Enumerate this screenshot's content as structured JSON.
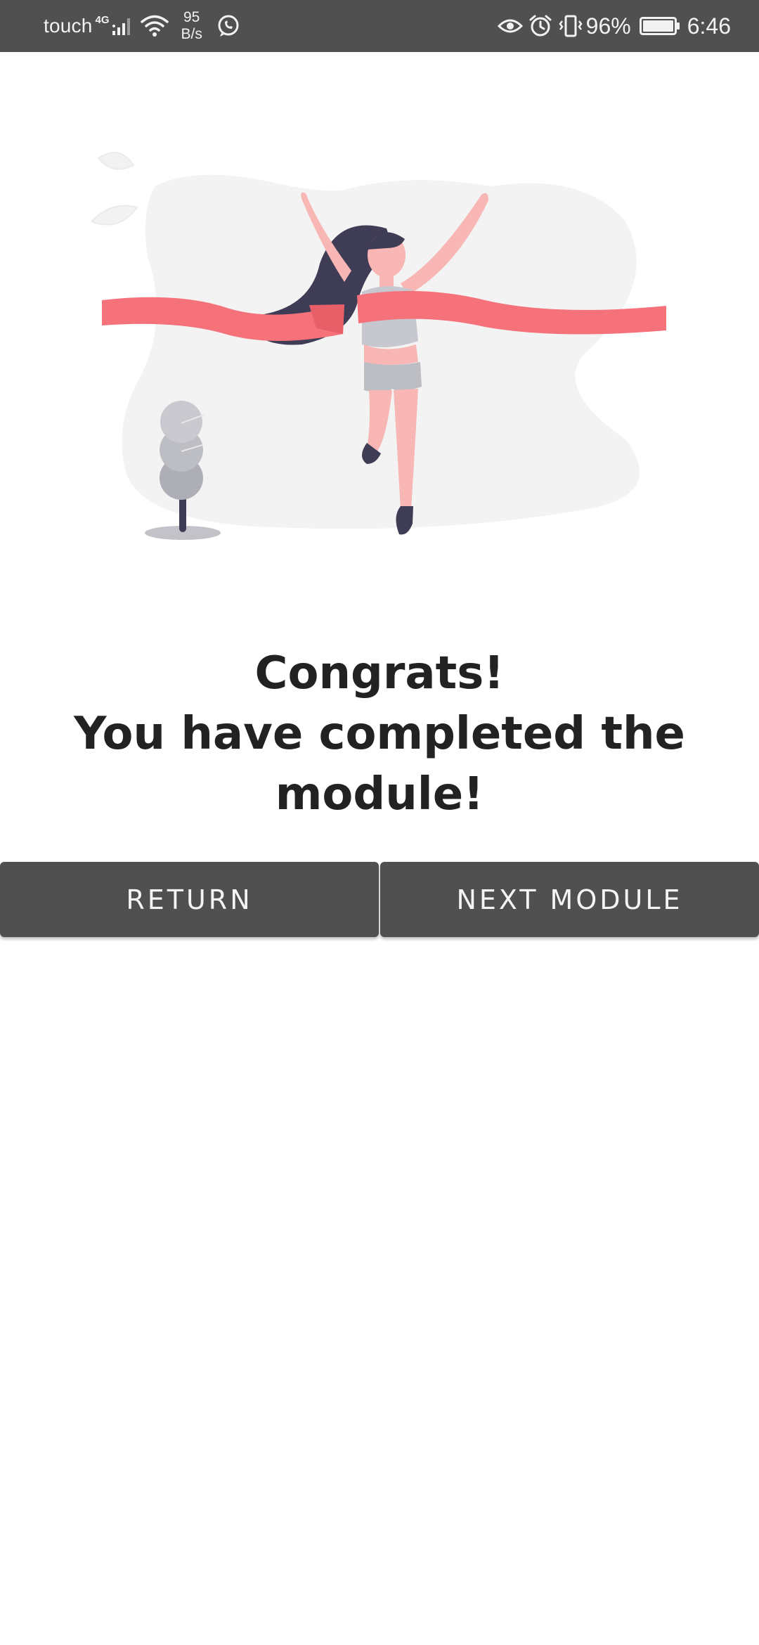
{
  "status_bar": {
    "carrier": "touch",
    "network_type": "4G",
    "speed_value": "95",
    "speed_unit": "B/s",
    "battery_percent": "96%",
    "time": "6:46",
    "icons": [
      "signal-icon",
      "wifi-icon",
      "whatsapp-icon",
      "eye-icon",
      "alarm-icon",
      "vibrate-icon",
      "battery-icon"
    ],
    "background_color": "#505050"
  },
  "illustration": {
    "subject": "woman-crossing-finish-line",
    "ribbon_color": "#f5727a",
    "hair_color": "#3f3d56",
    "skin_color": "#f8b6b4"
  },
  "message": {
    "line1": "Congrats!",
    "line2": "You have completed the",
    "line3": "module!"
  },
  "buttons": {
    "return_label": "RETURN",
    "next_label": "NEXT MODULE",
    "color": "#505050"
  }
}
